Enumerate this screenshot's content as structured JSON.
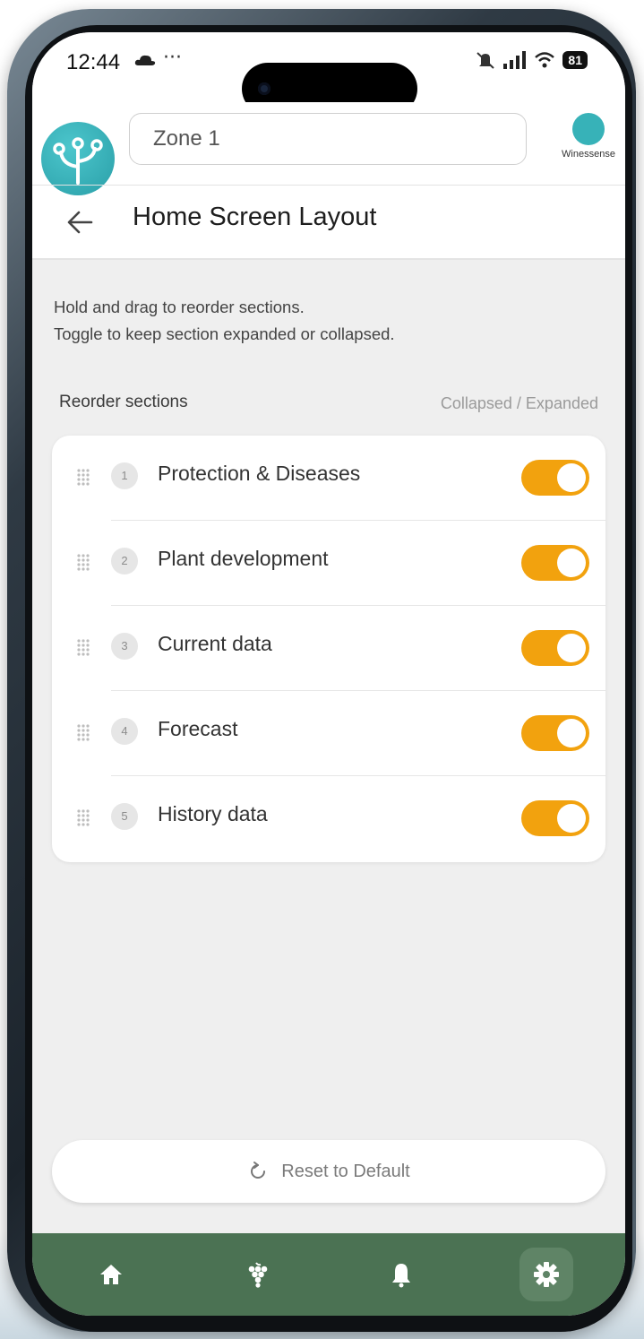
{
  "status_bar": {
    "time": "12:44",
    "more": "···",
    "battery": "81"
  },
  "header": {
    "zone_value": "Zone 1",
    "brand_name": "Winessense",
    "page_title": "Home Screen Layout"
  },
  "instructions": {
    "line1": "Hold and drag to reorder sections.",
    "line2": "Toggle to keep section expanded or collapsed."
  },
  "sections_header": {
    "title": "Reorder sections",
    "mode_hint": "Collapsed / Expanded"
  },
  "sections": [
    {
      "order": "1",
      "label": "Protection & Diseases",
      "expanded": true
    },
    {
      "order": "2",
      "label": "Plant development",
      "expanded": true
    },
    {
      "order": "3",
      "label": "Current data",
      "expanded": true
    },
    {
      "order": "4",
      "label": "Forecast",
      "expanded": true
    },
    {
      "order": "5",
      "label": "History data",
      "expanded": true
    }
  ],
  "reset_button": {
    "label": "Reset to Default"
  },
  "bottom_nav": [
    {
      "icon": "home-icon",
      "active": false
    },
    {
      "icon": "grapes-icon",
      "active": false
    },
    {
      "icon": "bell-icon",
      "active": false
    },
    {
      "icon": "gear-icon",
      "active": true
    }
  ],
  "colors": {
    "toggle_on": "#f2a20e",
    "nav_background": "#4b7253",
    "brand_teal": "#37b2b8"
  }
}
